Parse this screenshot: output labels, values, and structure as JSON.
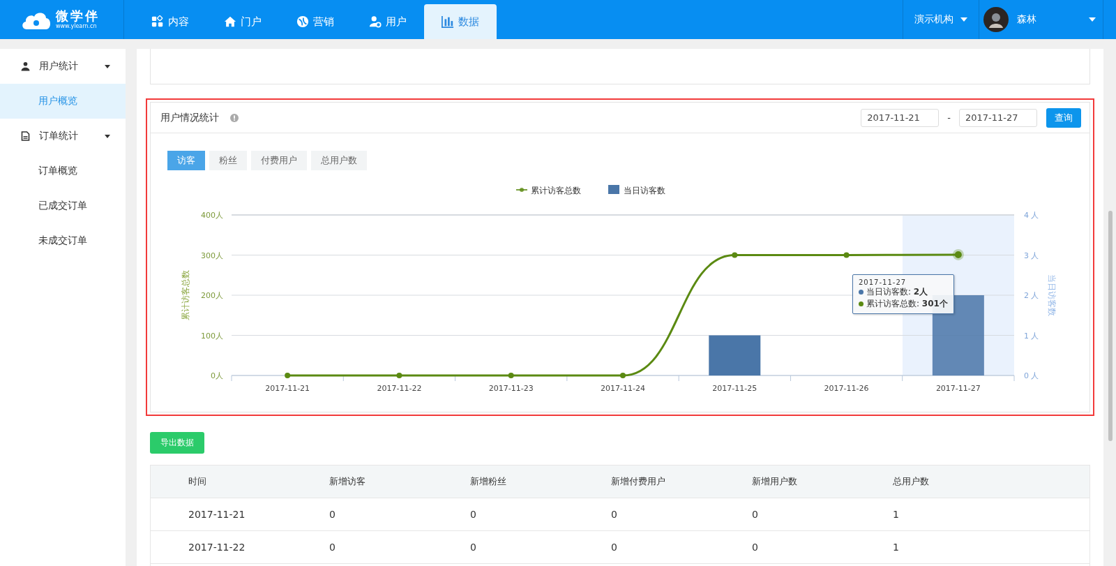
{
  "brand": {
    "name": "微学伴",
    "url": "www.ylearn.cn"
  },
  "nav": [
    {
      "label": "内容",
      "selected": false
    },
    {
      "label": "门户",
      "selected": false
    },
    {
      "label": "营销",
      "selected": false
    },
    {
      "label": "用户",
      "selected": false
    },
    {
      "label": "数据",
      "selected": true
    }
  ],
  "org": {
    "label": "演示机构"
  },
  "user": {
    "name": "森林"
  },
  "sidebar": [
    {
      "label": "用户统计",
      "expanded": true,
      "children": [
        {
          "label": "用户概览",
          "selected": true
        }
      ]
    },
    {
      "label": "订单统计",
      "expanded": true,
      "children": [
        {
          "label": "订单概览",
          "selected": false
        },
        {
          "label": "已成交订单",
          "selected": false
        },
        {
          "label": "未成交订单",
          "selected": false
        }
      ]
    }
  ],
  "panel": {
    "title": "用户情况统计",
    "date_from": "2017-11-21",
    "date_separator": "-",
    "date_to": "2017-11-27",
    "query_button": "查询",
    "tabs": [
      {
        "label": "访客",
        "selected": true
      },
      {
        "label": "粉丝",
        "selected": false
      },
      {
        "label": "付费用户",
        "selected": false
      },
      {
        "label": "总用户数",
        "selected": false
      }
    ],
    "chart_data": {
      "type": "bar",
      "ylabel": "累计访客总数",
      "y2label": "当日访客数",
      "categories": [
        "2017-11-21",
        "2017-11-22",
        "2017-11-23",
        "2017-11-24",
        "2017-11-25",
        "2017-11-26",
        "2017-11-27"
      ],
      "grid": true,
      "legend": "top",
      "series": [
        {
          "name": "累计访客总数",
          "type": "line",
          "marker": true,
          "color": "#5b8a12",
          "values": [
            0,
            0,
            0,
            0,
            300,
            300,
            301
          ]
        },
        {
          "name": "当日访客数",
          "type": "bar",
          "axis": "y2",
          "color": "#4a76a8",
          "values": [
            0,
            0,
            0,
            0,
            1,
            0,
            2
          ]
        }
      ],
      "ylim": [
        0,
        400
      ],
      "yticks": [
        {
          "value": 0,
          "label": "0人"
        },
        {
          "value": 100,
          "label": "100人"
        },
        {
          "value": 200,
          "label": "200人"
        },
        {
          "value": 300,
          "label": "300人"
        },
        {
          "value": 400,
          "label": "400人"
        }
      ],
      "y2lim": [
        0,
        4
      ],
      "y2ticks": [
        {
          "value": 0,
          "label": "0 人"
        },
        {
          "value": 1,
          "label": "1 人"
        },
        {
          "value": 2,
          "label": "2 人"
        },
        {
          "value": 3,
          "label": "3 人"
        },
        {
          "value": 4,
          "label": "4 人"
        }
      ]
    },
    "tooltip": {
      "title": "2017-11-27",
      "lines": [
        {
          "text": "当日访客数: **2人**",
          "color": "#4a76a8"
        },
        {
          "text": "累计访客总数: **301个**",
          "color": "#5b8a12"
        }
      ]
    }
  },
  "export_button": "导出数据",
  "table": {
    "columns": [
      "时间",
      "新增访客",
      "新增粉丝",
      "新增付费用户",
      "新增用户数",
      "总用户数"
    ],
    "rows": [
      [
        "2017-11-21",
        "0",
        "0",
        "0",
        "0",
        "1"
      ],
      [
        "2017-11-22",
        "0",
        "0",
        "0",
        "0",
        "1"
      ]
    ]
  }
}
